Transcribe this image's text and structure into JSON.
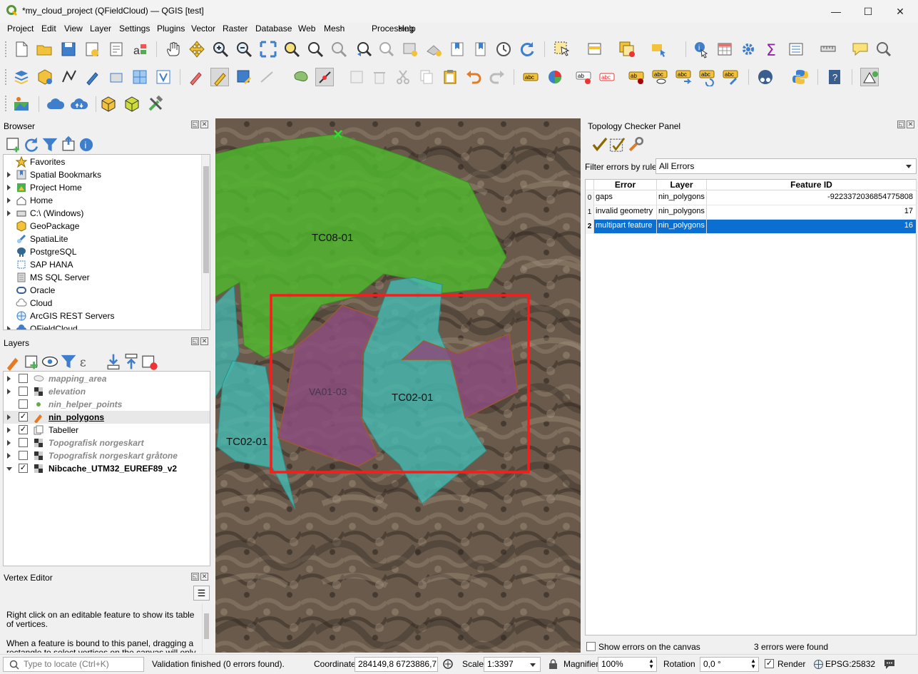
{
  "window": {
    "title": "*my_cloud_project (QFieldCloud) — QGIS [test]",
    "minimize": "—",
    "maximize": "☐",
    "close": "✕"
  },
  "menu": [
    "Project",
    "Edit",
    "View",
    "Layer",
    "Settings",
    "Plugins",
    "Vector",
    "Raster",
    "Database",
    "Web",
    "Mesh",
    "Processing",
    "Help"
  ],
  "browser": {
    "title": "Browser",
    "items": [
      "Favorites",
      "Spatial Bookmarks",
      "Project Home",
      "Home",
      "C:\\ (Windows)",
      "GeoPackage",
      "SpatiaLite",
      "PostgreSQL",
      "SAP HANA",
      "MS SQL Server",
      "Oracle",
      "Cloud",
      "ArcGIS REST Servers",
      "QFieldCloud"
    ]
  },
  "layers": {
    "title": "Layers",
    "items": [
      {
        "name": "mapping_area",
        "checked": false
      },
      {
        "name": "elevation",
        "checked": false
      },
      {
        "name": "nin_helper_points",
        "checked": false
      },
      {
        "name": "nin_polygons",
        "checked": true
      },
      {
        "name": "Tabeller",
        "checked": true
      },
      {
        "name": "Topografisk norgeskart",
        "checked": false
      },
      {
        "name": "Topografisk norgeskart gråtone",
        "checked": false
      },
      {
        "name": "Nibcache_UTM32_EUREF89_v2",
        "checked": true
      }
    ],
    "check_mark": "✓"
  },
  "vertex_editor": {
    "title": "Vertex Editor",
    "text1": "Right click on an editable feature to show its table of vertices.",
    "text2": "When a feature is bound to this panel, dragging a rectangle to select vertices on the canvas will only"
  },
  "map": {
    "labels": [
      "TC08-01",
      "VA01-03",
      "TC02-01",
      "TC02-01"
    ],
    "colors": {
      "green": "#4fb52e",
      "teal": "#43b9b2",
      "purple": "#8a4c7c",
      "red": "#ff1a1a"
    }
  },
  "topology": {
    "title": "Topology Checker Panel",
    "filter_label": "Filter errors by rule",
    "filter_value": "All Errors",
    "columns": [
      "Error",
      "Layer",
      "Feature ID"
    ],
    "rows": [
      {
        "num": "0",
        "error": "gaps",
        "layer": "nin_polygons",
        "fid": "-9223372036854775808"
      },
      {
        "num": "1",
        "error": "invalid geometry",
        "layer": "nin_polygons",
        "fid": "17"
      },
      {
        "num": "2",
        "error": "multipart feature",
        "layer": "nin_polygons",
        "fid": "16"
      }
    ],
    "show_errors": "Show errors on the canvas",
    "found": "3 errors were found"
  },
  "status": {
    "locate_placeholder": "Type to locate (Ctrl+K)",
    "message": "Validation finished (0 errors found).",
    "coordinate_label": "Coordinate",
    "coordinate": "284149,8  6723886,7",
    "scale_label": "Scale",
    "scale": "1:3397",
    "magnifier_label": "Magnifier",
    "magnifier": "100%",
    "rotation_label": "Rotation",
    "rotation": "0,0 °",
    "render_label": "Render",
    "crs": "EPSG:25832"
  }
}
